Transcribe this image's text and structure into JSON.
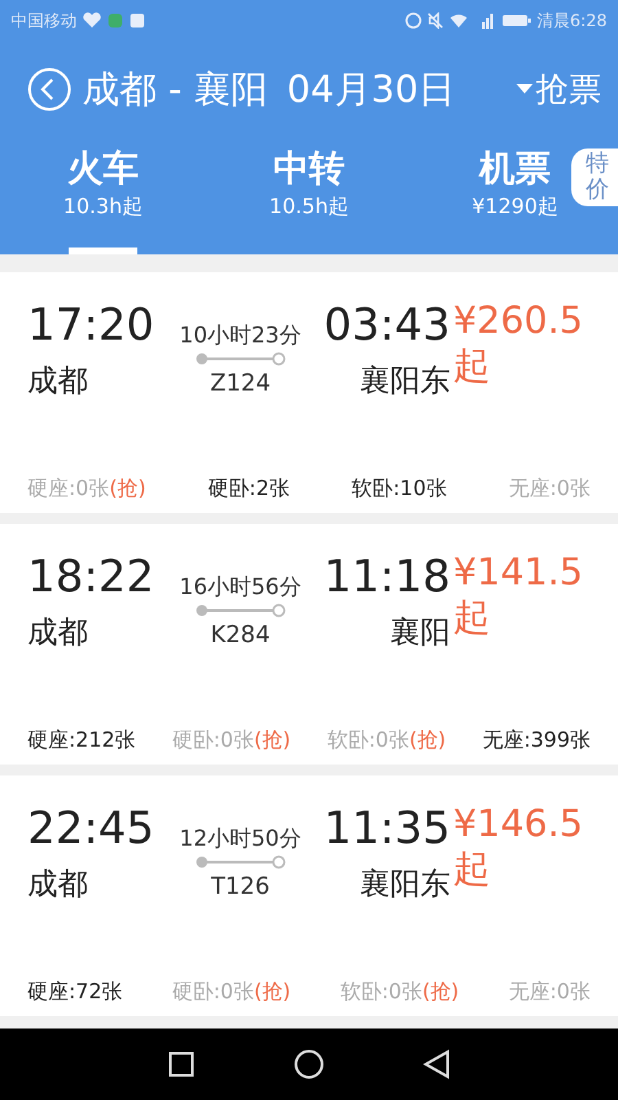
{
  "status_bar": {
    "carrier": "中国移动",
    "time": "清晨6:28"
  },
  "header": {
    "route": "成都 - 襄阳",
    "date": "04月30日",
    "action": "抢票"
  },
  "tabs": [
    {
      "label": "火车",
      "sub": "10.3h起",
      "selected": true
    },
    {
      "label": "中转",
      "sub": "10.5h起",
      "selected": false
    },
    {
      "label": "机票",
      "sub": "¥1290起",
      "selected": false,
      "badge": "特价"
    }
  ],
  "trains": [
    {
      "depart_time": "17:20",
      "depart_station": "成都",
      "duration": "10小时23分",
      "number": "Z124",
      "arrive_time": "03:43",
      "arrive_station": "襄阳东",
      "price": "¥260.5",
      "price_suffix": "起",
      "seats": [
        {
          "text": "硬座:0张",
          "available": false,
          "grab": "(抢)"
        },
        {
          "text": "硬卧:2张",
          "available": true
        },
        {
          "text": "软卧:10张",
          "available": true
        },
        {
          "text": "无座:0张",
          "available": false
        }
      ]
    },
    {
      "depart_time": "18:22",
      "depart_station": "成都",
      "duration": "16小时56分",
      "number": "K284",
      "arrive_time": "11:18",
      "arrive_station": "襄阳",
      "price": "¥141.5",
      "price_suffix": "起",
      "seats": [
        {
          "text": "硬座:212张",
          "available": true
        },
        {
          "text": "硬卧:0张",
          "available": false,
          "grab": "(抢)"
        },
        {
          "text": "软卧:0张",
          "available": false,
          "grab": "(抢)"
        },
        {
          "text": "无座:399张",
          "available": true
        }
      ]
    },
    {
      "depart_time": "22:45",
      "depart_station": "成都",
      "duration": "12小时50分",
      "number": "T126",
      "arrive_time": "11:35",
      "arrive_station": "襄阳东",
      "price": "¥146.5",
      "price_suffix": "起",
      "seats": [
        {
          "text": "硬座:72张",
          "available": true
        },
        {
          "text": "硬卧:0张",
          "available": false,
          "grab": "(抢)"
        },
        {
          "text": "软卧:0张",
          "available": false,
          "grab": "(抢)"
        },
        {
          "text": "无座:0张",
          "available": false
        }
      ]
    }
  ]
}
